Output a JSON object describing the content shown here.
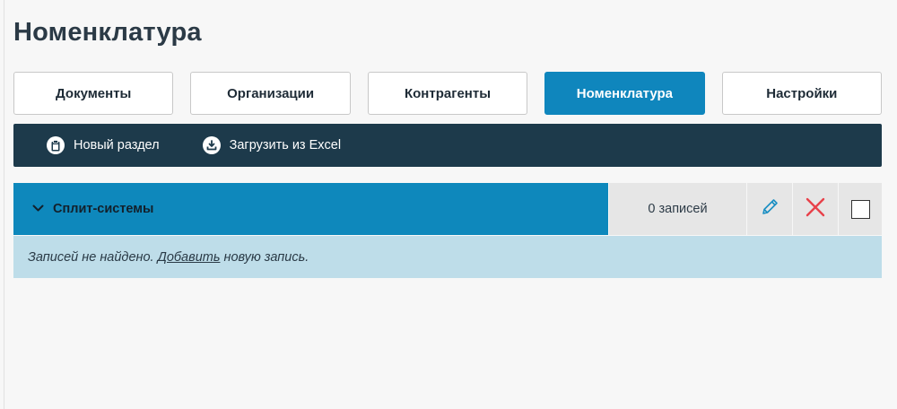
{
  "page": {
    "title": "Номенклатура"
  },
  "tabs": [
    {
      "label": "Документы",
      "active": false
    },
    {
      "label": "Организации",
      "active": false
    },
    {
      "label": "Контрагенты",
      "active": false
    },
    {
      "label": "Номенклатура",
      "active": true
    },
    {
      "label": "Настройки",
      "active": false
    }
  ],
  "toolbar": {
    "new_section_label": "Новый раздел",
    "new_section_icon": "clipboard-icon",
    "import_excel_label": "Загрузить из Excel",
    "import_excel_icon": "download-icon"
  },
  "section": {
    "name": "Сплит-системы",
    "expand_icon": "chevron-down-icon",
    "count_text": "0 записей",
    "edit_icon": "pencil-icon",
    "delete_icon": "close-icon",
    "checked": false
  },
  "empty_state": {
    "prefix": "Записей не найдено. ",
    "link": "Добавить",
    "suffix": " новую запись."
  },
  "colors": {
    "accent": "#0f86bd",
    "toolbar_bg": "#1d3a4b",
    "empty_bg": "#bedde9",
    "delete_red": "#e8414a"
  }
}
